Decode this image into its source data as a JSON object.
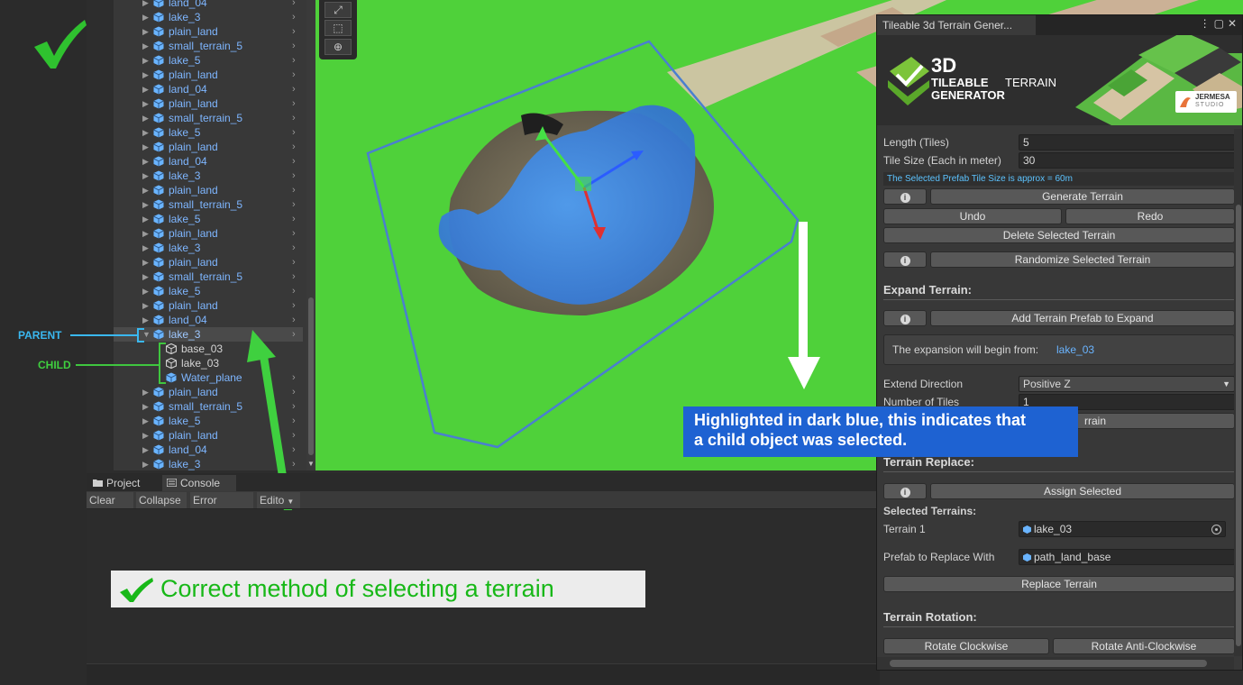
{
  "hierarchy": {
    "rows": [
      {
        "label": "land_04",
        "kind": "prefab"
      },
      {
        "label": "lake_3",
        "kind": "prefab"
      },
      {
        "label": "plain_land",
        "kind": "prefab"
      },
      {
        "label": "small_terrain_5",
        "kind": "prefab"
      },
      {
        "label": "lake_5",
        "kind": "prefab"
      },
      {
        "label": "plain_land",
        "kind": "prefab"
      },
      {
        "label": "land_04",
        "kind": "prefab"
      },
      {
        "label": "plain_land",
        "kind": "prefab"
      },
      {
        "label": "small_terrain_5",
        "kind": "prefab"
      },
      {
        "label": "lake_5",
        "kind": "prefab"
      },
      {
        "label": "plain_land",
        "kind": "prefab"
      },
      {
        "label": "land_04",
        "kind": "prefab"
      },
      {
        "label": "lake_3",
        "kind": "prefab"
      },
      {
        "label": "plain_land",
        "kind": "prefab"
      },
      {
        "label": "small_terrain_5",
        "kind": "prefab"
      },
      {
        "label": "lake_5",
        "kind": "prefab"
      },
      {
        "label": "plain_land",
        "kind": "prefab"
      },
      {
        "label": "lake_3",
        "kind": "prefab"
      },
      {
        "label": "plain_land",
        "kind": "prefab"
      },
      {
        "label": "small_terrain_5",
        "kind": "prefab"
      },
      {
        "label": "lake_5",
        "kind": "prefab"
      },
      {
        "label": "plain_land",
        "kind": "prefab"
      },
      {
        "label": "land_04",
        "kind": "prefab"
      },
      {
        "label": "lake_3",
        "kind": "parent"
      },
      {
        "label": "base_03",
        "kind": "child"
      },
      {
        "label": "lake_03",
        "kind": "child"
      },
      {
        "label": "Water_plane",
        "kind": "child-solid"
      },
      {
        "label": "plain_land",
        "kind": "prefab"
      },
      {
        "label": "small_terrain_5",
        "kind": "prefab"
      },
      {
        "label": "lake_5",
        "kind": "prefab"
      },
      {
        "label": "plain_land",
        "kind": "prefab"
      },
      {
        "label": "land_04",
        "kind": "prefab"
      },
      {
        "label": "lake_3",
        "kind": "prefab"
      }
    ]
  },
  "annotations": {
    "parent_label": "PARENT",
    "child_label": "CHILD",
    "caption": "Correct method of selecting a terrain",
    "note_line1": "Highlighted in dark blue, this indicates that",
    "note_line2": "a child object was selected."
  },
  "bottom_panel": {
    "tabs": [
      "Project",
      "Console"
    ],
    "toolbar": {
      "clear": "Clear",
      "collapse": "Collapse",
      "error_pause": "Error Pause",
      "editor": "Edito"
    }
  },
  "inspector": {
    "title": "Tileable 3d Terrain Gener...",
    "banner": {
      "logo_3d": "3D",
      "tileable": "TILEABLE",
      "terrain": "TERRAIN",
      "generator": "GENERATOR",
      "studio_name": "JERMESA",
      "studio_sub": "STUDIO"
    },
    "length_label": "Length (Tiles)",
    "length_value": "5",
    "tile_size_label": "Tile Size (Each in meter)",
    "tile_size_value": "30",
    "tile_size_note": "The Selected Prefab Tile Size is approx = 60m",
    "generate_button": "Generate Terrain",
    "undo_button": "Undo",
    "redo_button": "Redo",
    "delete_button": "Delete Selected Terrain",
    "randomize_button": "Randomize Selected Terrain",
    "expand": {
      "title": "Expand Terrain:",
      "add_button": "Add Terrain Prefab to Expand",
      "expansion_text": "The expansion will begin from:",
      "expansion_value": "lake_03",
      "direction_label": "Extend Direction",
      "direction_value": "Positive Z",
      "tiles_label": "Number of Tiles",
      "tiles_value": "1",
      "partial_button": "rrain"
    },
    "replace": {
      "title": "Terrain Replace:",
      "assign_button": "Assign Selected",
      "selected_label": "Selected Terrains:",
      "terrain1_label": "Terrain 1",
      "terrain1_value": "lake_03",
      "prefab_label": "Prefab to Replace With",
      "prefab_value": "path_land_base",
      "replace_button": "Replace Terrain"
    },
    "rotation": {
      "title": "Terrain Rotation:",
      "cw_button": "Rotate Clockwise",
      "ccw_button": "Rotate Anti-Clockwise"
    }
  },
  "colors": {
    "hierarchy_text": "#7eb6ff",
    "grass": "#4fd13a",
    "water": "#3f8ce6",
    "note_bg": "#1e62d2",
    "annotation_green": "#3fd03f",
    "annotation_blue": "#3ab8f0"
  }
}
